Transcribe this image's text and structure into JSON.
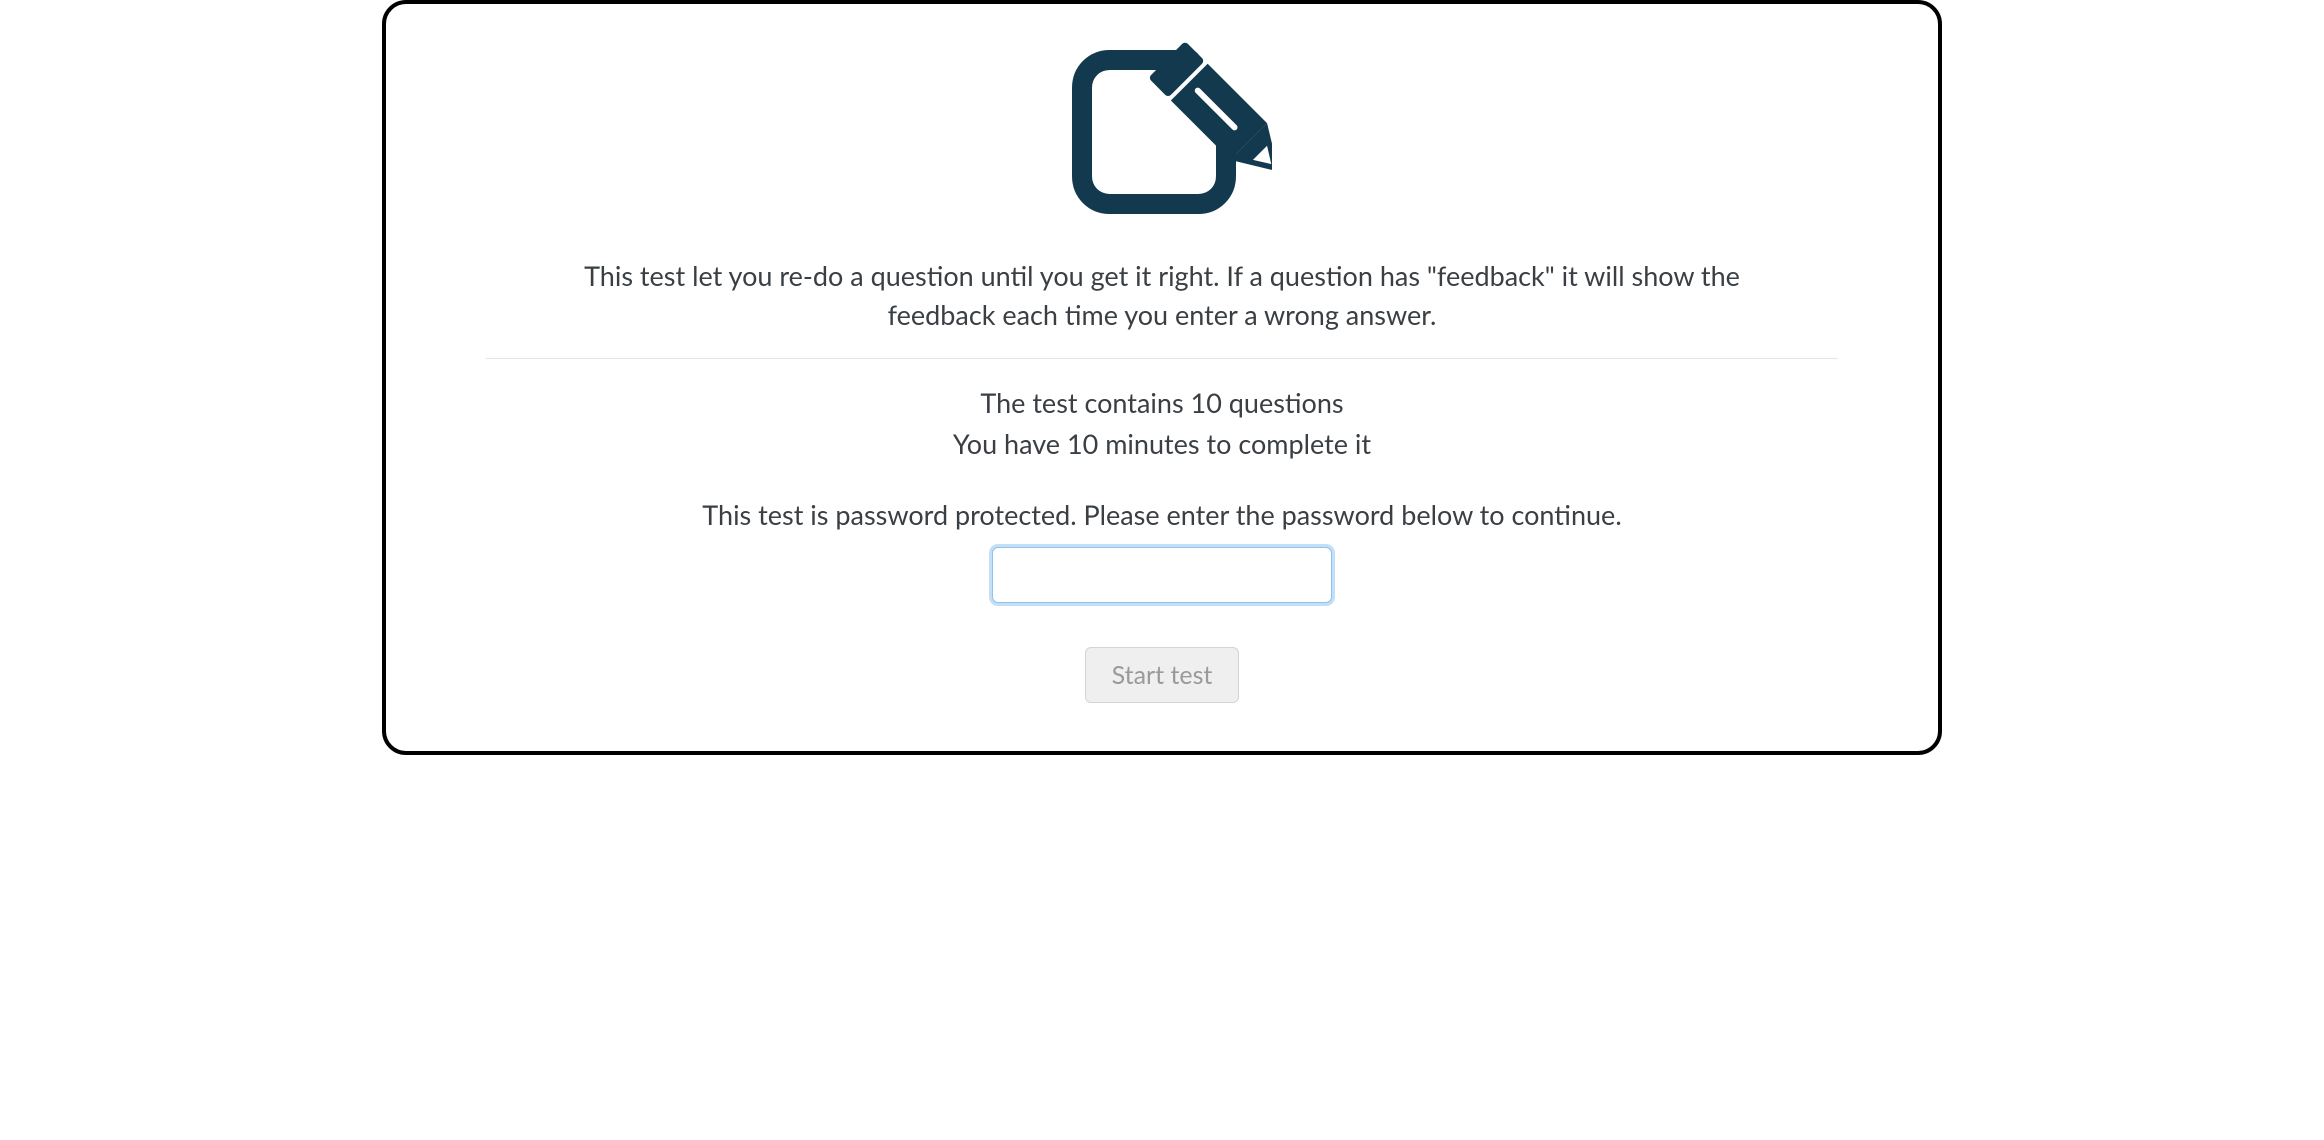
{
  "test": {
    "description": "This test let you re-do a question until you get it right. If a question has \"feedback\" it will show the feedback each time you enter a wrong answer.",
    "questions_line": "The test contains 10 questions",
    "time_line": "You have 10 minutes to complete it",
    "password_prompt": "This test is password protected. Please enter the password below to continue.",
    "password_value": "",
    "start_button_label": "Start test"
  },
  "colors": {
    "icon": "#12394d",
    "text": "#3a3f44"
  }
}
